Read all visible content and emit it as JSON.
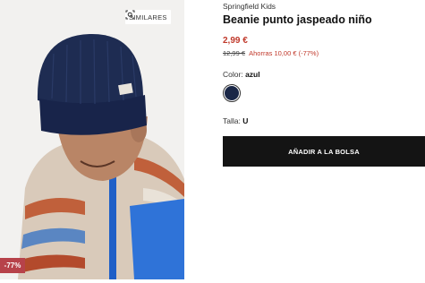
{
  "image": {
    "similar_label": "SIMILARES",
    "discount_badge": "-77%"
  },
  "product": {
    "brand": "Springfield Kids",
    "title": "Beanie punto jaspeado niño",
    "price": "2,99 €",
    "old_price": "12,99 €",
    "savings": "Ahorras 10,00 € (-77%)"
  },
  "color": {
    "label": "Color:",
    "value": "azul",
    "swatch_hex": "#1a2747"
  },
  "size": {
    "label": "Talla:",
    "value": "U"
  },
  "cart": {
    "add_label": "AÑADIR A LA BOLSA"
  },
  "colors": {
    "discount_red": "#b7424a",
    "price_red": "#c0392b",
    "button_black": "#141414"
  }
}
